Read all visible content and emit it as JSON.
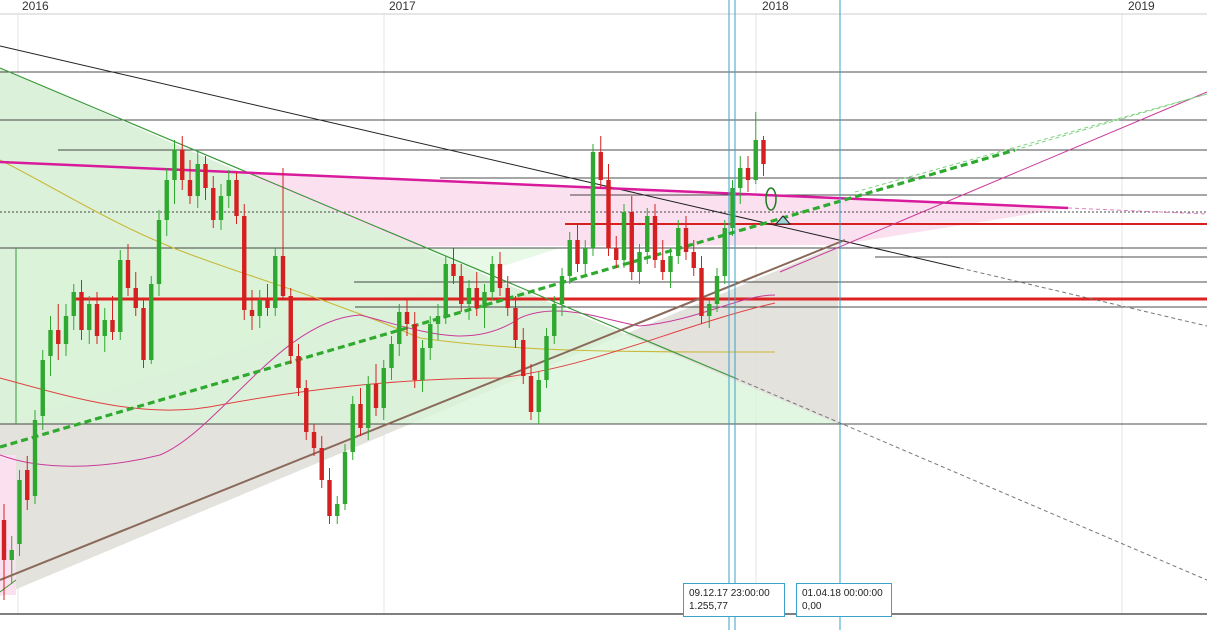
{
  "chart_data": {
    "type": "candlestick",
    "x_axis_labels": [
      "2016",
      "2017",
      "2018",
      "2019"
    ],
    "candles": [
      {
        "o": 1160,
        "h": 1168,
        "l": 1120,
        "c": 1140,
        "up": false
      },
      {
        "o": 1140,
        "h": 1152,
        "l": 1128,
        "c": 1145,
        "up": true
      },
      {
        "o": 1148,
        "h": 1185,
        "l": 1142,
        "c": 1180,
        "up": true
      },
      {
        "o": 1185,
        "h": 1192,
        "l": 1165,
        "c": 1170,
        "up": false
      },
      {
        "o": 1172,
        "h": 1215,
        "l": 1168,
        "c": 1210,
        "up": true
      },
      {
        "o": 1212,
        "h": 1245,
        "l": 1205,
        "c": 1240,
        "up": true
      },
      {
        "o": 1242,
        "h": 1262,
        "l": 1232,
        "c": 1255,
        "up": true
      },
      {
        "o": 1255,
        "h": 1268,
        "l": 1240,
        "c": 1248,
        "up": false
      },
      {
        "o": 1248,
        "h": 1268,
        "l": 1242,
        "c": 1262,
        "up": true
      },
      {
        "o": 1262,
        "h": 1278,
        "l": 1255,
        "c": 1274,
        "up": true
      },
      {
        "o": 1274,
        "h": 1280,
        "l": 1250,
        "c": 1255,
        "up": false
      },
      {
        "o": 1255,
        "h": 1272,
        "l": 1248,
        "c": 1268,
        "up": true
      },
      {
        "o": 1268,
        "h": 1274,
        "l": 1248,
        "c": 1252,
        "up": false
      },
      {
        "o": 1252,
        "h": 1266,
        "l": 1244,
        "c": 1260,
        "up": true
      },
      {
        "o": 1260,
        "h": 1272,
        "l": 1250,
        "c": 1254,
        "up": false
      },
      {
        "o": 1254,
        "h": 1295,
        "l": 1250,
        "c": 1290,
        "up": true
      },
      {
        "o": 1290,
        "h": 1298,
        "l": 1272,
        "c": 1276,
        "up": false
      },
      {
        "o": 1276,
        "h": 1284,
        "l": 1262,
        "c": 1266,
        "up": false
      },
      {
        "o": 1266,
        "h": 1270,
        "l": 1236,
        "c": 1240,
        "up": false
      },
      {
        "o": 1240,
        "h": 1282,
        "l": 1238,
        "c": 1278,
        "up": true
      },
      {
        "o": 1278,
        "h": 1315,
        "l": 1272,
        "c": 1310,
        "up": true
      },
      {
        "o": 1310,
        "h": 1336,
        "l": 1302,
        "c": 1330,
        "up": true
      },
      {
        "o": 1330,
        "h": 1350,
        "l": 1318,
        "c": 1345,
        "up": true
      },
      {
        "o": 1345,
        "h": 1352,
        "l": 1325,
        "c": 1330,
        "up": false
      },
      {
        "o": 1330,
        "h": 1340,
        "l": 1318,
        "c": 1322,
        "up": false
      },
      {
        "o": 1322,
        "h": 1345,
        "l": 1316,
        "c": 1338,
        "up": true
      },
      {
        "o": 1338,
        "h": 1342,
        "l": 1320,
        "c": 1326,
        "up": false
      },
      {
        "o": 1326,
        "h": 1332,
        "l": 1306,
        "c": 1310,
        "up": false
      },
      {
        "o": 1310,
        "h": 1328,
        "l": 1305,
        "c": 1322,
        "up": true
      },
      {
        "o": 1322,
        "h": 1335,
        "l": 1316,
        "c": 1330,
        "up": true
      },
      {
        "o": 1330,
        "h": 1334,
        "l": 1308,
        "c": 1312,
        "up": false
      },
      {
        "o": 1312,
        "h": 1318,
        "l": 1260,
        "c": 1265,
        "up": false
      },
      {
        "o": 1265,
        "h": 1275,
        "l": 1255,
        "c": 1262,
        "up": false
      },
      {
        "o": 1262,
        "h": 1275,
        "l": 1256,
        "c": 1270,
        "up": true
      },
      {
        "o": 1270,
        "h": 1278,
        "l": 1262,
        "c": 1266,
        "up": false
      },
      {
        "o": 1266,
        "h": 1296,
        "l": 1262,
        "c": 1292,
        "up": true
      },
      {
        "o": 1292,
        "h": 1336,
        "l": 1270,
        "c": 1272,
        "up": false
      },
      {
        "o": 1272,
        "h": 1276,
        "l": 1238,
        "c": 1242,
        "up": false
      },
      {
        "o": 1242,
        "h": 1248,
        "l": 1222,
        "c": 1226,
        "up": false
      },
      {
        "o": 1226,
        "h": 1230,
        "l": 1200,
        "c": 1204,
        "up": false
      },
      {
        "o": 1204,
        "h": 1208,
        "l": 1192,
        "c": 1196,
        "up": false
      },
      {
        "o": 1196,
        "h": 1202,
        "l": 1176,
        "c": 1180,
        "up": false
      },
      {
        "o": 1180,
        "h": 1186,
        "l": 1158,
        "c": 1162,
        "up": false
      },
      {
        "o": 1162,
        "h": 1172,
        "l": 1158,
        "c": 1168,
        "up": true
      },
      {
        "o": 1168,
        "h": 1198,
        "l": 1165,
        "c": 1194,
        "up": true
      },
      {
        "o": 1194,
        "h": 1222,
        "l": 1190,
        "c": 1218,
        "up": true
      },
      {
        "o": 1218,
        "h": 1226,
        "l": 1202,
        "c": 1206,
        "up": false
      },
      {
        "o": 1206,
        "h": 1232,
        "l": 1200,
        "c": 1228,
        "up": true
      },
      {
        "o": 1228,
        "h": 1238,
        "l": 1212,
        "c": 1216,
        "up": false
      },
      {
        "o": 1216,
        "h": 1240,
        "l": 1210,
        "c": 1236,
        "up": true
      },
      {
        "o": 1236,
        "h": 1252,
        "l": 1230,
        "c": 1248,
        "up": true
      },
      {
        "o": 1248,
        "h": 1268,
        "l": 1242,
        "c": 1264,
        "up": true
      },
      {
        "o": 1264,
        "h": 1270,
        "l": 1252,
        "c": 1258,
        "up": false
      },
      {
        "o": 1258,
        "h": 1264,
        "l": 1226,
        "c": 1230,
        "up": false
      },
      {
        "o": 1230,
        "h": 1250,
        "l": 1224,
        "c": 1246,
        "up": true
      },
      {
        "o": 1246,
        "h": 1262,
        "l": 1240,
        "c": 1258,
        "up": true
      },
      {
        "o": 1258,
        "h": 1268,
        "l": 1250,
        "c": 1262,
        "up": true
      },
      {
        "o": 1262,
        "h": 1292,
        "l": 1258,
        "c": 1288,
        "up": true
      },
      {
        "o": 1288,
        "h": 1296,
        "l": 1278,
        "c": 1282,
        "up": false
      },
      {
        "o": 1282,
        "h": 1288,
        "l": 1264,
        "c": 1268,
        "up": false
      },
      {
        "o": 1268,
        "h": 1280,
        "l": 1260,
        "c": 1276,
        "up": true
      },
      {
        "o": 1276,
        "h": 1284,
        "l": 1262,
        "c": 1266,
        "up": false
      },
      {
        "o": 1266,
        "h": 1278,
        "l": 1256,
        "c": 1274,
        "up": true
      },
      {
        "o": 1274,
        "h": 1292,
        "l": 1270,
        "c": 1288,
        "up": true
      },
      {
        "o": 1288,
        "h": 1294,
        "l": 1272,
        "c": 1276,
        "up": false
      },
      {
        "o": 1276,
        "h": 1282,
        "l": 1262,
        "c": 1266,
        "up": false
      },
      {
        "o": 1266,
        "h": 1272,
        "l": 1246,
        "c": 1250,
        "up": false
      },
      {
        "o": 1250,
        "h": 1256,
        "l": 1228,
        "c": 1232,
        "up": false
      },
      {
        "o": 1232,
        "h": 1238,
        "l": 1210,
        "c": 1214,
        "up": false
      },
      {
        "o": 1214,
        "h": 1234,
        "l": 1208,
        "c": 1230,
        "up": true
      },
      {
        "o": 1230,
        "h": 1256,
        "l": 1226,
        "c": 1252,
        "up": true
      },
      {
        "o": 1252,
        "h": 1272,
        "l": 1248,
        "c": 1268,
        "up": true
      },
      {
        "o": 1268,
        "h": 1286,
        "l": 1262,
        "c": 1282,
        "up": true
      },
      {
        "o": 1282,
        "h": 1304,
        "l": 1278,
        "c": 1300,
        "up": true
      },
      {
        "o": 1300,
        "h": 1308,
        "l": 1284,
        "c": 1288,
        "up": false
      },
      {
        "o": 1288,
        "h": 1300,
        "l": 1282,
        "c": 1296,
        "up": true
      },
      {
        "o": 1296,
        "h": 1348,
        "l": 1292,
        "c": 1344,
        "up": true
      },
      {
        "o": 1344,
        "h": 1352,
        "l": 1326,
        "c": 1330,
        "up": false
      },
      {
        "o": 1330,
        "h": 1338,
        "l": 1292,
        "c": 1296,
        "up": false
      },
      {
        "o": 1296,
        "h": 1302,
        "l": 1286,
        "c": 1290,
        "up": false
      },
      {
        "o": 1290,
        "h": 1318,
        "l": 1286,
        "c": 1314,
        "up": true
      },
      {
        "o": 1314,
        "h": 1322,
        "l": 1280,
        "c": 1284,
        "up": false
      },
      {
        "o": 1284,
        "h": 1298,
        "l": 1278,
        "c": 1294,
        "up": true
      },
      {
        "o": 1294,
        "h": 1316,
        "l": 1288,
        "c": 1312,
        "up": true
      },
      {
        "o": 1312,
        "h": 1318,
        "l": 1286,
        "c": 1290,
        "up": false
      },
      {
        "o": 1290,
        "h": 1300,
        "l": 1280,
        "c": 1284,
        "up": false
      },
      {
        "o": 1284,
        "h": 1296,
        "l": 1276,
        "c": 1292,
        "up": true
      },
      {
        "o": 1292,
        "h": 1310,
        "l": 1288,
        "c": 1306,
        "up": true
      },
      {
        "o": 1306,
        "h": 1312,
        "l": 1290,
        "c": 1294,
        "up": false
      },
      {
        "o": 1294,
        "h": 1300,
        "l": 1282,
        "c": 1286,
        "up": false
      },
      {
        "o": 1286,
        "h": 1292,
        "l": 1258,
        "c": 1262,
        "up": false
      },
      {
        "o": 1262,
        "h": 1270,
        "l": 1256,
        "c": 1268,
        "up": true
      },
      {
        "o": 1268,
        "h": 1286,
        "l": 1264,
        "c": 1282,
        "up": true
      },
      {
        "o": 1282,
        "h": 1310,
        "l": 1278,
        "c": 1306,
        "up": true
      },
      {
        "o": 1306,
        "h": 1330,
        "l": 1302,
        "c": 1326,
        "up": true
      },
      {
        "o": 1326,
        "h": 1342,
        "l": 1318,
        "c": 1336,
        "up": true
      },
      {
        "o": 1336,
        "h": 1342,
        "l": 1324,
        "c": 1330,
        "up": false
      },
      {
        "o": 1330,
        "h": 1364,
        "l": 1328,
        "c": 1350,
        "up": true
      },
      {
        "o": 1350,
        "h": 1352,
        "l": 1332,
        "c": 1338,
        "up": false
      }
    ],
    "overlay_lines": {
      "pink_resistance": {
        "color": "#d81b9c"
      },
      "green_dashed_trend": {
        "color": "#2faa2f"
      },
      "brown_support": {
        "color": "#8a6a5a"
      },
      "green_downtrend": {
        "color": "#3a9a3a"
      },
      "black_downtrend": {
        "color": "#222222"
      },
      "red_horizontal": {
        "color": "#dd2222"
      }
    },
    "colors": {
      "up": "#2ea82e",
      "down": "#d42020",
      "pink_fill": "#fbe0f0",
      "green_fill": "#d9f5d9",
      "gray_fill": "#e2e0da",
      "cursor_line": "#3aa3c9"
    },
    "tooltips": [
      {
        "line1": "09.12.17 23:00:00",
        "line2": "1.255,77"
      },
      {
        "line1": "01.04.18 00:00:00",
        "line2": "0,00"
      }
    ]
  }
}
